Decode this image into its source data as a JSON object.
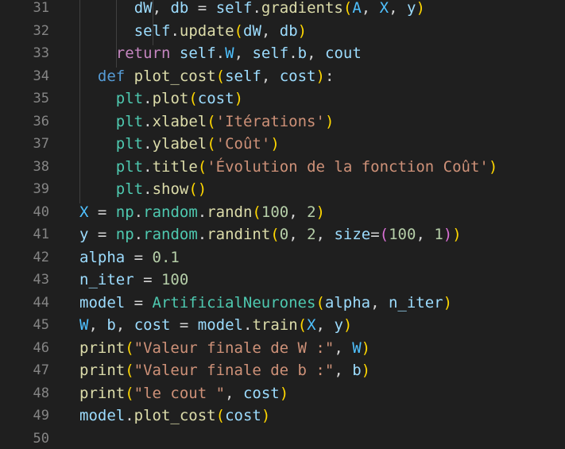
{
  "editor": {
    "language": "python",
    "lines": [
      {
        "number": "31",
        "indent": 6,
        "tokens": [
          {
            "t": "dW",
            "c": "var"
          },
          {
            "t": ", ",
            "c": "op"
          },
          {
            "t": "db",
            "c": "var"
          },
          {
            "t": " = ",
            "c": "op"
          },
          {
            "t": "self",
            "c": "self"
          },
          {
            "t": ".",
            "c": "op"
          },
          {
            "t": "gradients",
            "c": "fn"
          },
          {
            "t": "(",
            "c": "b1"
          },
          {
            "t": "A",
            "c": "cst"
          },
          {
            "t": ", ",
            "c": "op"
          },
          {
            "t": "X",
            "c": "cst"
          },
          {
            "t": ", ",
            "c": "op"
          },
          {
            "t": "y",
            "c": "var"
          },
          {
            "t": ")",
            "c": "b1"
          }
        ]
      },
      {
        "number": "32",
        "indent": 6,
        "tokens": [
          {
            "t": "self",
            "c": "self"
          },
          {
            "t": ".",
            "c": "op"
          },
          {
            "t": "update",
            "c": "fn"
          },
          {
            "t": "(",
            "c": "b1"
          },
          {
            "t": "dW",
            "c": "var"
          },
          {
            "t": ", ",
            "c": "op"
          },
          {
            "t": "db",
            "c": "var"
          },
          {
            "t": ")",
            "c": "b1"
          }
        ]
      },
      {
        "number": "33",
        "indent": 4,
        "tokens": [
          {
            "t": "return",
            "c": "ret"
          },
          {
            "t": " ",
            "c": "op"
          },
          {
            "t": "self",
            "c": "self"
          },
          {
            "t": ".",
            "c": "op"
          },
          {
            "t": "W",
            "c": "cst"
          },
          {
            "t": ", ",
            "c": "op"
          },
          {
            "t": "self",
            "c": "self"
          },
          {
            "t": ".",
            "c": "op"
          },
          {
            "t": "b",
            "c": "var"
          },
          {
            "t": ", ",
            "c": "op"
          },
          {
            "t": "cout",
            "c": "var"
          }
        ]
      },
      {
        "number": "34",
        "indent": 2,
        "tokens": [
          {
            "t": "def",
            "c": "kw"
          },
          {
            "t": " ",
            "c": "op"
          },
          {
            "t": "plot_cost",
            "c": "fn"
          },
          {
            "t": "(",
            "c": "b1"
          },
          {
            "t": "self",
            "c": "self"
          },
          {
            "t": ", ",
            "c": "op"
          },
          {
            "t": "cost",
            "c": "var"
          },
          {
            "t": ")",
            "c": "b1"
          },
          {
            "t": ":",
            "c": "op"
          }
        ]
      },
      {
        "number": "35",
        "indent": 4,
        "tokens": [
          {
            "t": "plt",
            "c": "cls"
          },
          {
            "t": ".",
            "c": "op"
          },
          {
            "t": "plot",
            "c": "fn"
          },
          {
            "t": "(",
            "c": "b1"
          },
          {
            "t": "cost",
            "c": "var"
          },
          {
            "t": ")",
            "c": "b1"
          }
        ]
      },
      {
        "number": "36",
        "indent": 4,
        "tokens": [
          {
            "t": "plt",
            "c": "cls"
          },
          {
            "t": ".",
            "c": "op"
          },
          {
            "t": "xlabel",
            "c": "fn"
          },
          {
            "t": "(",
            "c": "b1"
          },
          {
            "t": "'Itérations'",
            "c": "str"
          },
          {
            "t": ")",
            "c": "b1"
          }
        ]
      },
      {
        "number": "37",
        "indent": 4,
        "tokens": [
          {
            "t": "plt",
            "c": "cls"
          },
          {
            "t": ".",
            "c": "op"
          },
          {
            "t": "ylabel",
            "c": "fn"
          },
          {
            "t": "(",
            "c": "b1"
          },
          {
            "t": "'Coût'",
            "c": "str"
          },
          {
            "t": ")",
            "c": "b1"
          }
        ]
      },
      {
        "number": "38",
        "indent": 4,
        "tokens": [
          {
            "t": "plt",
            "c": "cls"
          },
          {
            "t": ".",
            "c": "op"
          },
          {
            "t": "title",
            "c": "fn"
          },
          {
            "t": "(",
            "c": "b1"
          },
          {
            "t": "'Évolution de la fonction Coût'",
            "c": "str"
          },
          {
            "t": ")",
            "c": "b1"
          }
        ]
      },
      {
        "number": "39",
        "indent": 4,
        "tokens": [
          {
            "t": "plt",
            "c": "cls"
          },
          {
            "t": ".",
            "c": "op"
          },
          {
            "t": "show",
            "c": "fn"
          },
          {
            "t": "()",
            "c": "b1"
          }
        ]
      },
      {
        "number": "40",
        "indent": 0,
        "tokens": [
          {
            "t": "X",
            "c": "cst"
          },
          {
            "t": " = ",
            "c": "op"
          },
          {
            "t": "np",
            "c": "cls"
          },
          {
            "t": ".",
            "c": "op"
          },
          {
            "t": "random",
            "c": "cls"
          },
          {
            "t": ".",
            "c": "op"
          },
          {
            "t": "randn",
            "c": "fn"
          },
          {
            "t": "(",
            "c": "b1"
          },
          {
            "t": "100",
            "c": "num"
          },
          {
            "t": ", ",
            "c": "op"
          },
          {
            "t": "2",
            "c": "num"
          },
          {
            "t": ")",
            "c": "b1"
          }
        ]
      },
      {
        "number": "41",
        "indent": 0,
        "tokens": [
          {
            "t": "y",
            "c": "var"
          },
          {
            "t": " = ",
            "c": "op"
          },
          {
            "t": "np",
            "c": "cls"
          },
          {
            "t": ".",
            "c": "op"
          },
          {
            "t": "random",
            "c": "cls"
          },
          {
            "t": ".",
            "c": "op"
          },
          {
            "t": "randint",
            "c": "fn"
          },
          {
            "t": "(",
            "c": "b1"
          },
          {
            "t": "0",
            "c": "num"
          },
          {
            "t": ", ",
            "c": "op"
          },
          {
            "t": "2",
            "c": "num"
          },
          {
            "t": ", ",
            "c": "op"
          },
          {
            "t": "size",
            "c": "var"
          },
          {
            "t": "=",
            "c": "op"
          },
          {
            "t": "(",
            "c": "b2"
          },
          {
            "t": "100",
            "c": "num"
          },
          {
            "t": ", ",
            "c": "op"
          },
          {
            "t": "1",
            "c": "num"
          },
          {
            "t": ")",
            "c": "b2"
          },
          {
            "t": ")",
            "c": "b1"
          }
        ]
      },
      {
        "number": "42",
        "indent": 0,
        "tokens": [
          {
            "t": "alpha",
            "c": "var"
          },
          {
            "t": " = ",
            "c": "op"
          },
          {
            "t": "0.1",
            "c": "num"
          }
        ]
      },
      {
        "number": "43",
        "indent": 0,
        "tokens": [
          {
            "t": "n_iter",
            "c": "var"
          },
          {
            "t": " = ",
            "c": "op"
          },
          {
            "t": "100",
            "c": "num"
          }
        ]
      },
      {
        "number": "44",
        "indent": 0,
        "tokens": [
          {
            "t": "model",
            "c": "var"
          },
          {
            "t": " = ",
            "c": "op"
          },
          {
            "t": "ArtificialNeurones",
            "c": "cls"
          },
          {
            "t": "(",
            "c": "b1"
          },
          {
            "t": "alpha",
            "c": "var"
          },
          {
            "t": ", ",
            "c": "op"
          },
          {
            "t": "n_iter",
            "c": "var"
          },
          {
            "t": ")",
            "c": "b1"
          }
        ]
      },
      {
        "number": "45",
        "indent": 0,
        "tokens": [
          {
            "t": "W",
            "c": "cst"
          },
          {
            "t": ", ",
            "c": "op"
          },
          {
            "t": "b",
            "c": "var"
          },
          {
            "t": ", ",
            "c": "op"
          },
          {
            "t": "cost",
            "c": "var"
          },
          {
            "t": " = ",
            "c": "op"
          },
          {
            "t": "model",
            "c": "var"
          },
          {
            "t": ".",
            "c": "op"
          },
          {
            "t": "train",
            "c": "fn"
          },
          {
            "t": "(",
            "c": "b1"
          },
          {
            "t": "X",
            "c": "cst"
          },
          {
            "t": ", ",
            "c": "op"
          },
          {
            "t": "y",
            "c": "var"
          },
          {
            "t": ")",
            "c": "b1"
          }
        ]
      },
      {
        "number": "46",
        "indent": 0,
        "tokens": [
          {
            "t": "print",
            "c": "fn"
          },
          {
            "t": "(",
            "c": "b1"
          },
          {
            "t": "\"Valeur finale de W :\"",
            "c": "str"
          },
          {
            "t": ", ",
            "c": "op"
          },
          {
            "t": "W",
            "c": "cst"
          },
          {
            "t": ")",
            "c": "b1"
          }
        ]
      },
      {
        "number": "47",
        "indent": 0,
        "tokens": [
          {
            "t": "print",
            "c": "fn"
          },
          {
            "t": "(",
            "c": "b1"
          },
          {
            "t": "\"Valeur finale de b :\"",
            "c": "str"
          },
          {
            "t": ", ",
            "c": "op"
          },
          {
            "t": "b",
            "c": "var"
          },
          {
            "t": ")",
            "c": "b1"
          }
        ]
      },
      {
        "number": "48",
        "indent": 0,
        "tokens": [
          {
            "t": "print",
            "c": "fn"
          },
          {
            "t": "(",
            "c": "b1"
          },
          {
            "t": "\"le cout \"",
            "c": "str"
          },
          {
            "t": ", ",
            "c": "op"
          },
          {
            "t": "cost",
            "c": "var"
          },
          {
            "t": ")",
            "c": "b1"
          }
        ]
      },
      {
        "number": "49",
        "indent": 0,
        "tokens": [
          {
            "t": "model",
            "c": "var"
          },
          {
            "t": ".",
            "c": "op"
          },
          {
            "t": "plot_cost",
            "c": "fn"
          },
          {
            "t": "(",
            "c": "b1"
          },
          {
            "t": "cost",
            "c": "var"
          },
          {
            "t": ")",
            "c": "b1"
          }
        ]
      },
      {
        "number": "50",
        "indent": 0,
        "tokens": []
      }
    ]
  },
  "colors": {
    "background": "#1f1f1f",
    "line_number": "#858585",
    "keyword": "#569cd6",
    "control_keyword": "#c586c0",
    "function": "#dcdcaa",
    "variable": "#9cdcfe",
    "string": "#ce9178",
    "number": "#b5cea8",
    "class": "#4ec9b0",
    "constant": "#4fc1ff",
    "bracket_1": "#ffd700",
    "bracket_2": "#da70d6"
  }
}
